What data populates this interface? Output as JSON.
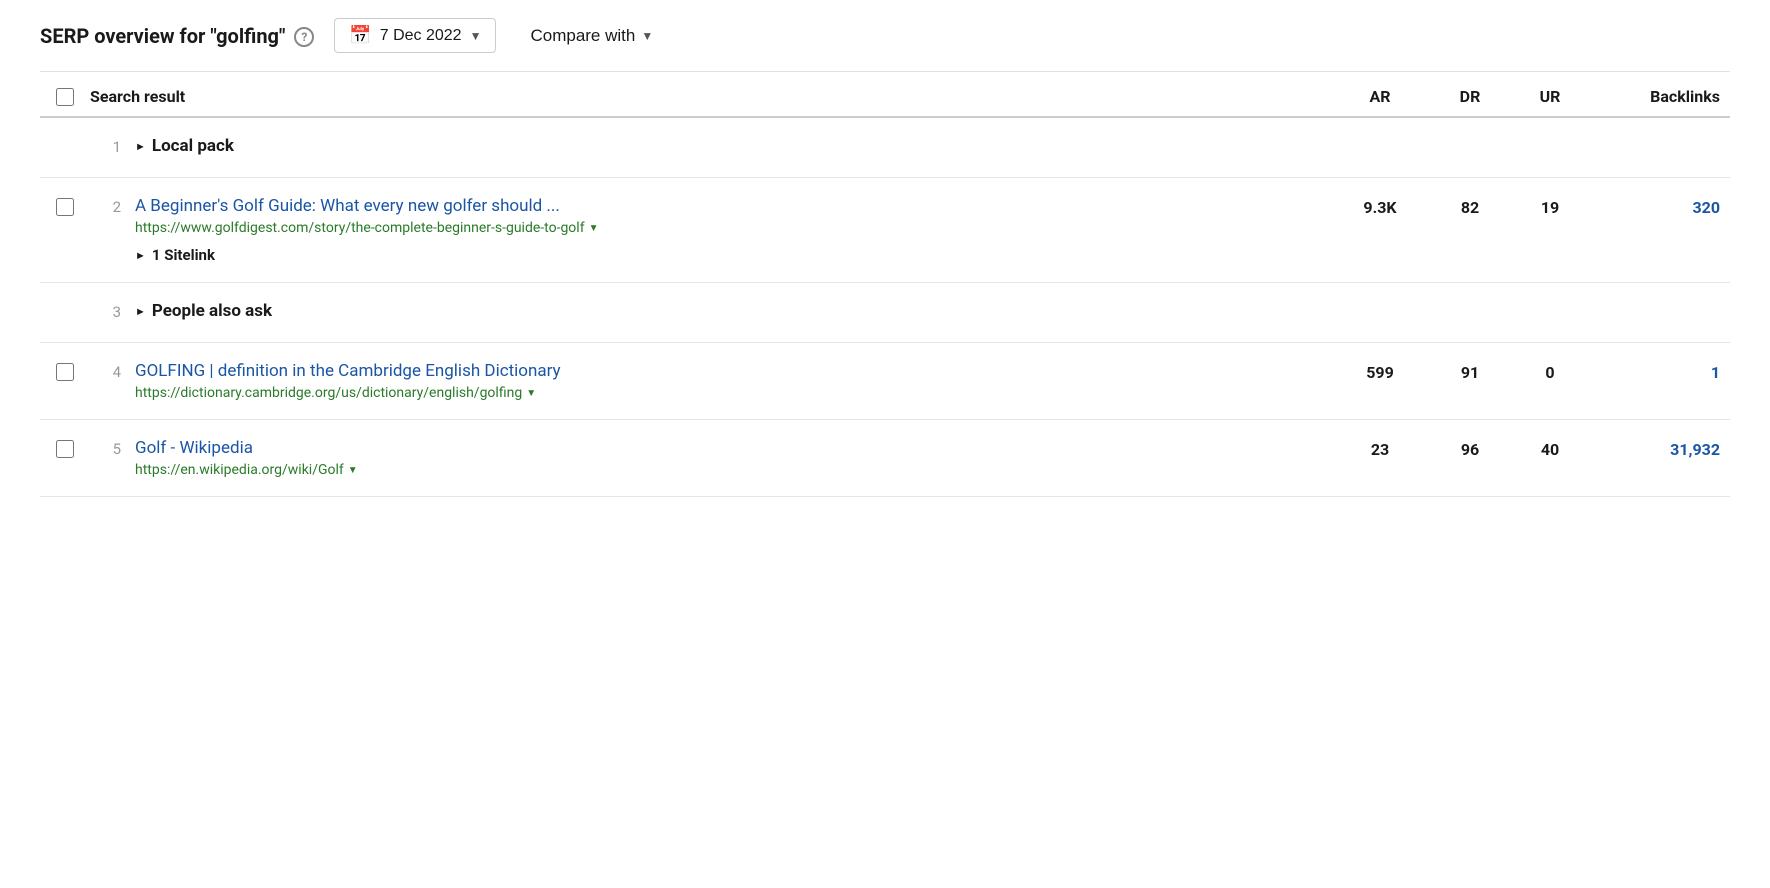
{
  "header": {
    "title_prefix": "SERP overview for",
    "keyword": "\"golfing\"",
    "date": "7 Dec 2022",
    "compare_label": "Compare with",
    "help_icon": "?"
  },
  "table": {
    "columns": {
      "result_label": "Search result",
      "ar_label": "AR",
      "dr_label": "DR",
      "ur_label": "UR",
      "backlinks_label": "Backlinks"
    },
    "rows": [
      {
        "id": "row-1",
        "number": "1",
        "type": "category",
        "has_checkbox": false,
        "title": "Local pack",
        "url": "",
        "ar": "",
        "dr": "",
        "ur": "",
        "backlinks": "",
        "backlinks_is_link": false
      },
      {
        "id": "row-2",
        "number": "2",
        "type": "result",
        "has_checkbox": true,
        "title": "A Beginner's Golf Guide: What every new golfer should ...",
        "url": "https://www.golfdigest.com/story/the-complete-beginner-s-guide-to-golf",
        "sitelink": "1 Sitelink",
        "ar": "9.3K",
        "dr": "82",
        "ur": "19",
        "backlinks": "320",
        "backlinks_is_link": true
      },
      {
        "id": "row-3",
        "number": "3",
        "type": "category",
        "has_checkbox": false,
        "title": "People also ask",
        "url": "",
        "ar": "",
        "dr": "",
        "ur": "",
        "backlinks": "",
        "backlinks_is_link": false
      },
      {
        "id": "row-4",
        "number": "4",
        "type": "result",
        "has_checkbox": true,
        "title": "GOLFING | definition in the Cambridge English Dictionary",
        "url": "https://dictionary.cambridge.org/us/dictionary/english/golfing",
        "sitelink": "",
        "ar": "599",
        "dr": "91",
        "ur": "0",
        "backlinks": "1",
        "backlinks_is_link": true
      },
      {
        "id": "row-5",
        "number": "5",
        "type": "result",
        "has_checkbox": true,
        "title": "Golf - Wikipedia",
        "url": "https://en.wikipedia.org/wiki/Golf",
        "sitelink": "",
        "ar": "23",
        "dr": "96",
        "ur": "40",
        "backlinks": "31,932",
        "backlinks_is_link": true
      }
    ]
  }
}
